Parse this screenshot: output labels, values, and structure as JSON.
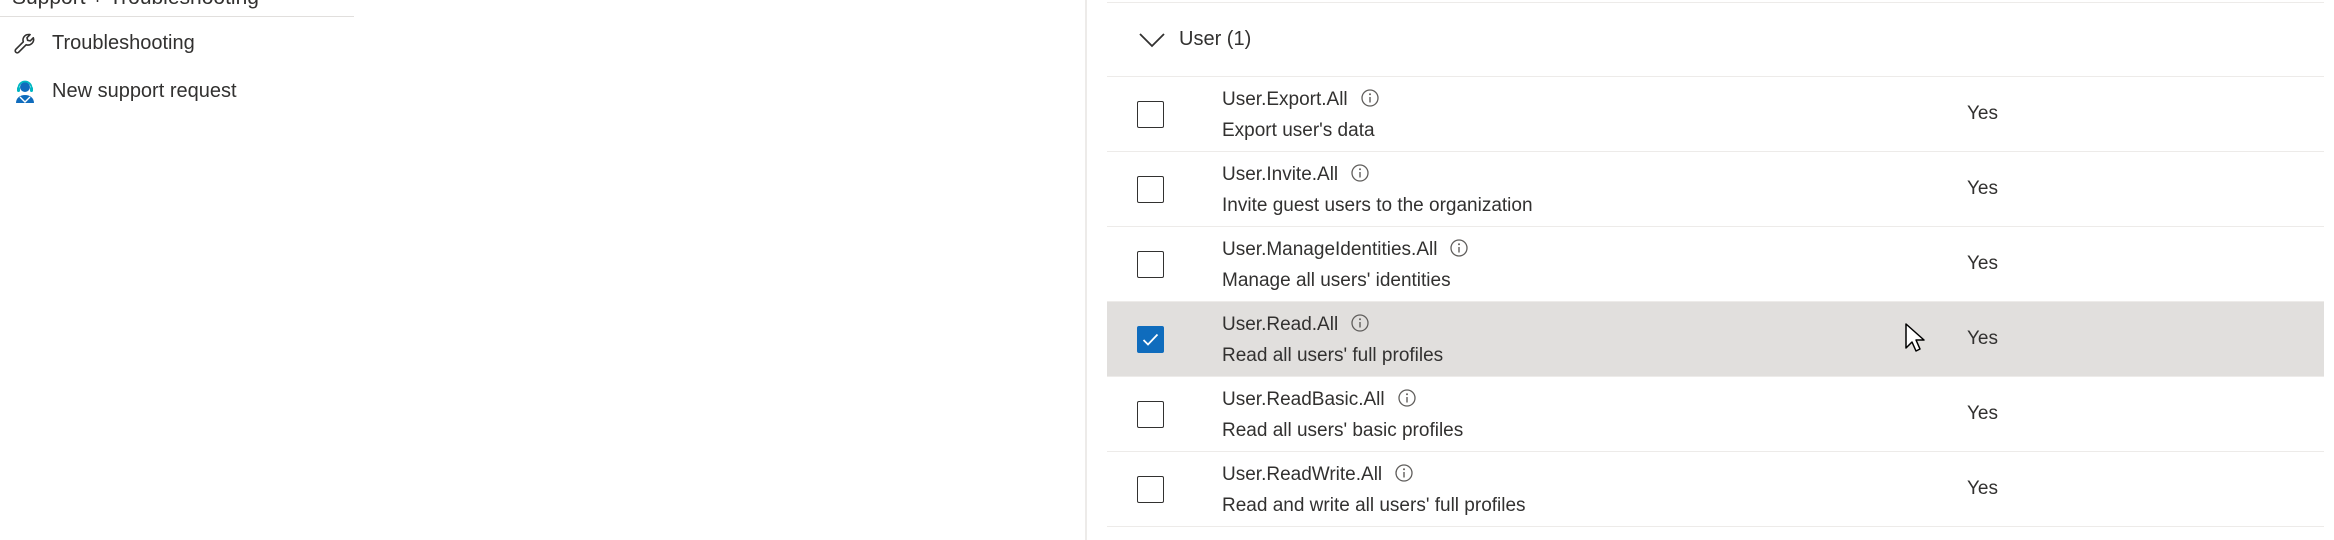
{
  "left_nav": {
    "heading": "Support + Troubleshooting",
    "items": [
      {
        "label": "Troubleshooting",
        "icon": "wrench-icon"
      },
      {
        "label": "New support request",
        "icon": "support-person-icon"
      }
    ]
  },
  "group": {
    "label": "User (1)",
    "expanded": true
  },
  "permissions": [
    {
      "name": "User.Export.All",
      "description": "Export user's data",
      "admin_consent": "Yes",
      "checked": false
    },
    {
      "name": "User.Invite.All",
      "description": "Invite guest users to the organization",
      "admin_consent": "Yes",
      "checked": false
    },
    {
      "name": "User.ManageIdentities.All",
      "description": "Manage all users' identities",
      "admin_consent": "Yes",
      "checked": false
    },
    {
      "name": "User.Read.All",
      "description": "Read all users' full profiles",
      "admin_consent": "Yes",
      "checked": true
    },
    {
      "name": "User.ReadBasic.All",
      "description": "Read all users' basic profiles",
      "admin_consent": "Yes",
      "checked": false
    },
    {
      "name": "User.ReadWrite.All",
      "description": "Read and write all users' full profiles",
      "admin_consent": "Yes",
      "checked": false
    }
  ],
  "colors": {
    "accent": "#0f6cbd",
    "selected_row": "#e1dfdd",
    "text": "#323130",
    "divider": "#edebe9"
  }
}
